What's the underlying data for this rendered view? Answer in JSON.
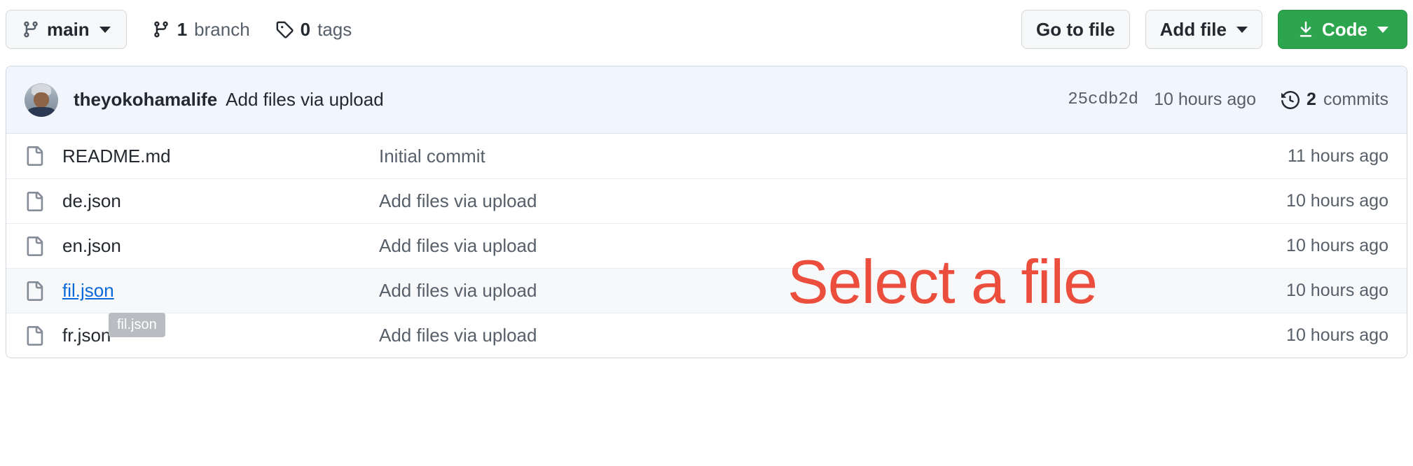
{
  "toolbar": {
    "branch_button": {
      "label": "main",
      "icon": "branch-icon"
    },
    "branch_count": {
      "num": "1",
      "label": "branch"
    },
    "tag_count": {
      "num": "0",
      "label": "tags"
    },
    "go_to_file": "Go to file",
    "add_file": "Add file",
    "code": "Code"
  },
  "commit_bar": {
    "author": "theyokohamalife",
    "message": "Add files via upload",
    "sha": "25cdb2d",
    "time": "10 hours ago",
    "commit_count_num": "2",
    "commit_count_label": "commits"
  },
  "files": [
    {
      "name": "README.md",
      "message": "Initial commit",
      "time": "11 hours ago",
      "hovered": false
    },
    {
      "name": "de.json",
      "message": "Add files via upload",
      "time": "10 hours ago",
      "hovered": false
    },
    {
      "name": "en.json",
      "message": "Add files via upload",
      "time": "10 hours ago",
      "hovered": false
    },
    {
      "name": "fil.json",
      "message": "Add files via upload",
      "time": "10 hours ago",
      "hovered": true
    },
    {
      "name": "fr.json",
      "message": "Add files via upload",
      "time": "10 hours ago",
      "hovered": false
    }
  ],
  "overlay": {
    "annotation": "Select a file",
    "annotation_color": "#ec4e3d",
    "tooltip": "fil.json"
  },
  "colors": {
    "green": "#2da44e",
    "link": "#0969da",
    "commit_bar_bg": "#f1f6fe",
    "row_hover": "#f6f8fa",
    "border": "#d0d7de"
  }
}
